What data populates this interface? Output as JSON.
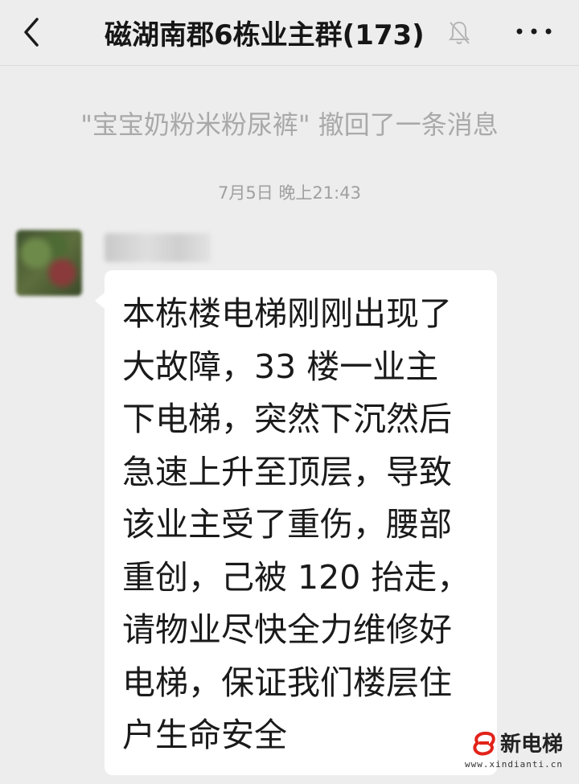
{
  "header": {
    "title": "磁湖南郡6栋业主群(173)",
    "back_icon": "chevron-left-icon",
    "mute_icon": "bell-off-icon",
    "more_icon": "more-horizontal-icon"
  },
  "messages": {
    "system_notice": "\"宝宝奶粉米粉尿裤\" 撤回了一条消息",
    "timestamp": "7月5日 晚上21:43",
    "chat_message": {
      "text": "本栋楼电梯刚刚出现了\n大故障，33 楼一业主\n下电梯，突然下沉然后\n急速上升至顶层，导致\n该业主受了重伤，腰部\n重创，己被 120 抬走，\n请物业尽快全力维修好\n电梯，保证我们楼层住\n户生命安全"
    }
  },
  "watermark": {
    "title": "新电梯",
    "url": "www.xindianti.cn",
    "color": "#e2231a"
  },
  "colors": {
    "background": "#ededed",
    "bubble": "#ffffff"
  }
}
